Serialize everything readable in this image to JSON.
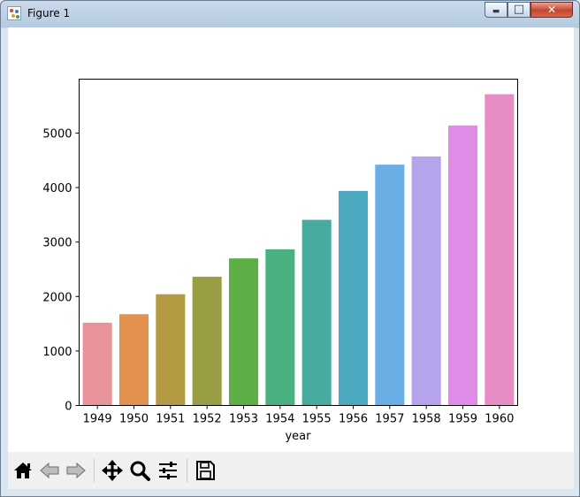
{
  "window": {
    "title": "Figure 1"
  },
  "titlebar": {
    "minimize_glyph": "▬",
    "maximize_glyph": "□",
    "close_glyph": "✕"
  },
  "toolbar": {
    "items": [
      {
        "name": "home-button",
        "icon": "home-icon"
      },
      {
        "name": "back-button",
        "icon": "back-arrow-icon"
      },
      {
        "name": "forward-button",
        "icon": "forward-arrow-icon"
      },
      {
        "name": "pan-button",
        "icon": "pan-move-icon"
      },
      {
        "name": "zoom-button",
        "icon": "zoom-magnifier-icon"
      },
      {
        "name": "subplots-button",
        "icon": "sliders-icon"
      },
      {
        "name": "save-button",
        "icon": "floppy-disk-icon"
      }
    ]
  },
  "chart_data": {
    "type": "bar",
    "xlabel": "year",
    "ylabel": "",
    "categories": [
      "1949",
      "1950",
      "1951",
      "1952",
      "1953",
      "1954",
      "1955",
      "1956",
      "1957",
      "1958",
      "1959",
      "1960"
    ],
    "values": [
      1520,
      1676,
      2042,
      2364,
      2700,
      2867,
      3408,
      3939,
      4421,
      4572,
      5140,
      5714
    ],
    "colors": [
      "#e8939b",
      "#e2914f",
      "#b59a44",
      "#999e44",
      "#5cae45",
      "#4ab07f",
      "#48aba0",
      "#4aa8bf",
      "#6aaee6",
      "#b5a3ec",
      "#df8be8",
      "#e88cc6"
    ],
    "ylim": [
      0,
      6000
    ],
    "yticks": [
      0,
      1000,
      2000,
      3000,
      4000,
      5000
    ],
    "grid": false,
    "legend": "none"
  }
}
